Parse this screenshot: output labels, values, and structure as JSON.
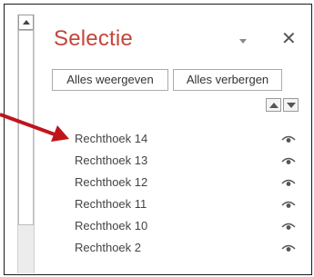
{
  "pane": {
    "title": "Selectie",
    "show_all_label": "Alles weergeven",
    "hide_all_label": "Alles verbergen",
    "close_glyph": "✕"
  },
  "layers": [
    {
      "label": "Rechthoek 14",
      "visible": true
    },
    {
      "label": "Rechthoek 13",
      "visible": true
    },
    {
      "label": "Rechthoek 12",
      "visible": true
    },
    {
      "label": "Rechthoek 11",
      "visible": true
    },
    {
      "label": "Rechthoek 10",
      "visible": true
    },
    {
      "label": "Rechthoek 2",
      "visible": true
    }
  ],
  "colors": {
    "title": "#c5453b",
    "annotation_arrow": "#c0141b"
  },
  "icons": [
    "chevron-up-icon",
    "dropdown-caret-icon",
    "close-icon",
    "bring-forward-icon",
    "send-backward-icon",
    "eye-icon",
    "annotation-arrow"
  ]
}
